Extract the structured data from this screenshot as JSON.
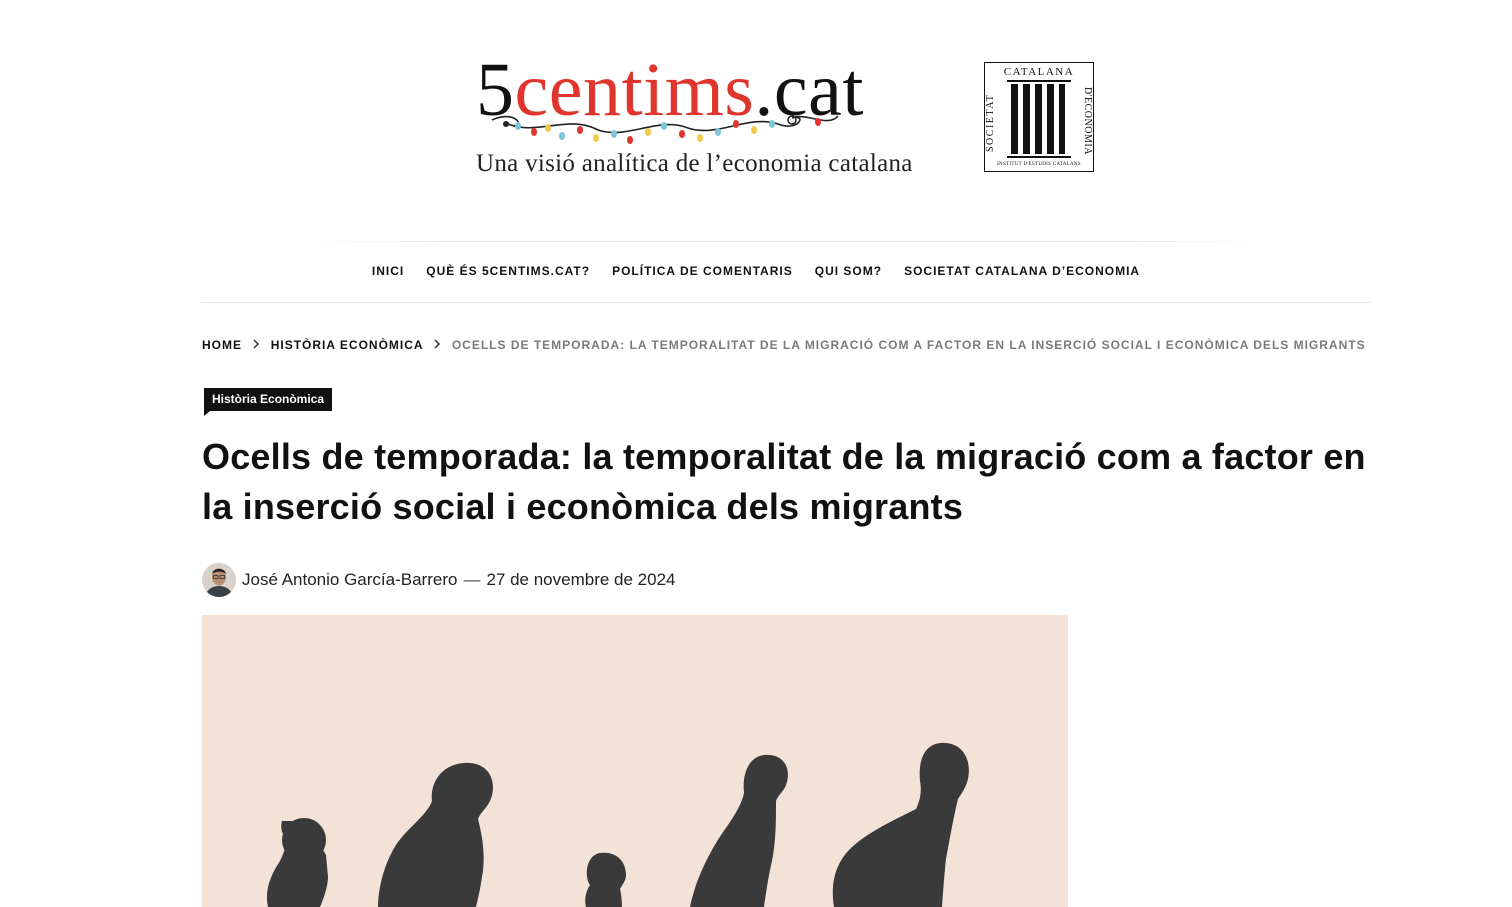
{
  "header": {
    "logo": {
      "part1": "5",
      "part2": "centims",
      "part3": ".cat"
    },
    "tagline": "Una visió analítica de l’economia catalana",
    "partner_logo": {
      "top": "CATALANA",
      "left": "SOCIETAT",
      "right": "D'ECONOMIA",
      "bottom": "INSTITUT D'ESTUDIS CATALANS"
    }
  },
  "nav": {
    "items": [
      {
        "label": "INICI"
      },
      {
        "label": "QUÈ ÉS 5CENTIMS.CAT?"
      },
      {
        "label": "POLÍTICA DE COMENTARIS"
      },
      {
        "label": "QUI SOM?"
      },
      {
        "label": "SOCIETAT CATALANA D’ECONOMIA"
      }
    ]
  },
  "breadcrumb": {
    "home": "HOME",
    "category": "HISTÒRIA ECONÒMICA",
    "current": "OCELLS DE TEMPORADA: LA TEMPORALITAT DE LA MIGRACIÓ COM A FACTOR EN LA INSERCIÓ SOCIAL I ECONÒMICA DELS MIGRANTS"
  },
  "article": {
    "category": "Història Econòmica",
    "title": "Ocells de temporada: la temporalitat de la migració com a factor en la inserció social i econòmica dels migrants",
    "author": "José Antonio García-Barrero",
    "separator": "—",
    "date": "27 de novembre de 2024"
  },
  "colors": {
    "accent": "#e0352d",
    "hero_bg": "#f3e2d7",
    "silhouette": "#3a3a3a"
  },
  "icons": {
    "breadcrumb_separator": "chevron-right-icon"
  }
}
